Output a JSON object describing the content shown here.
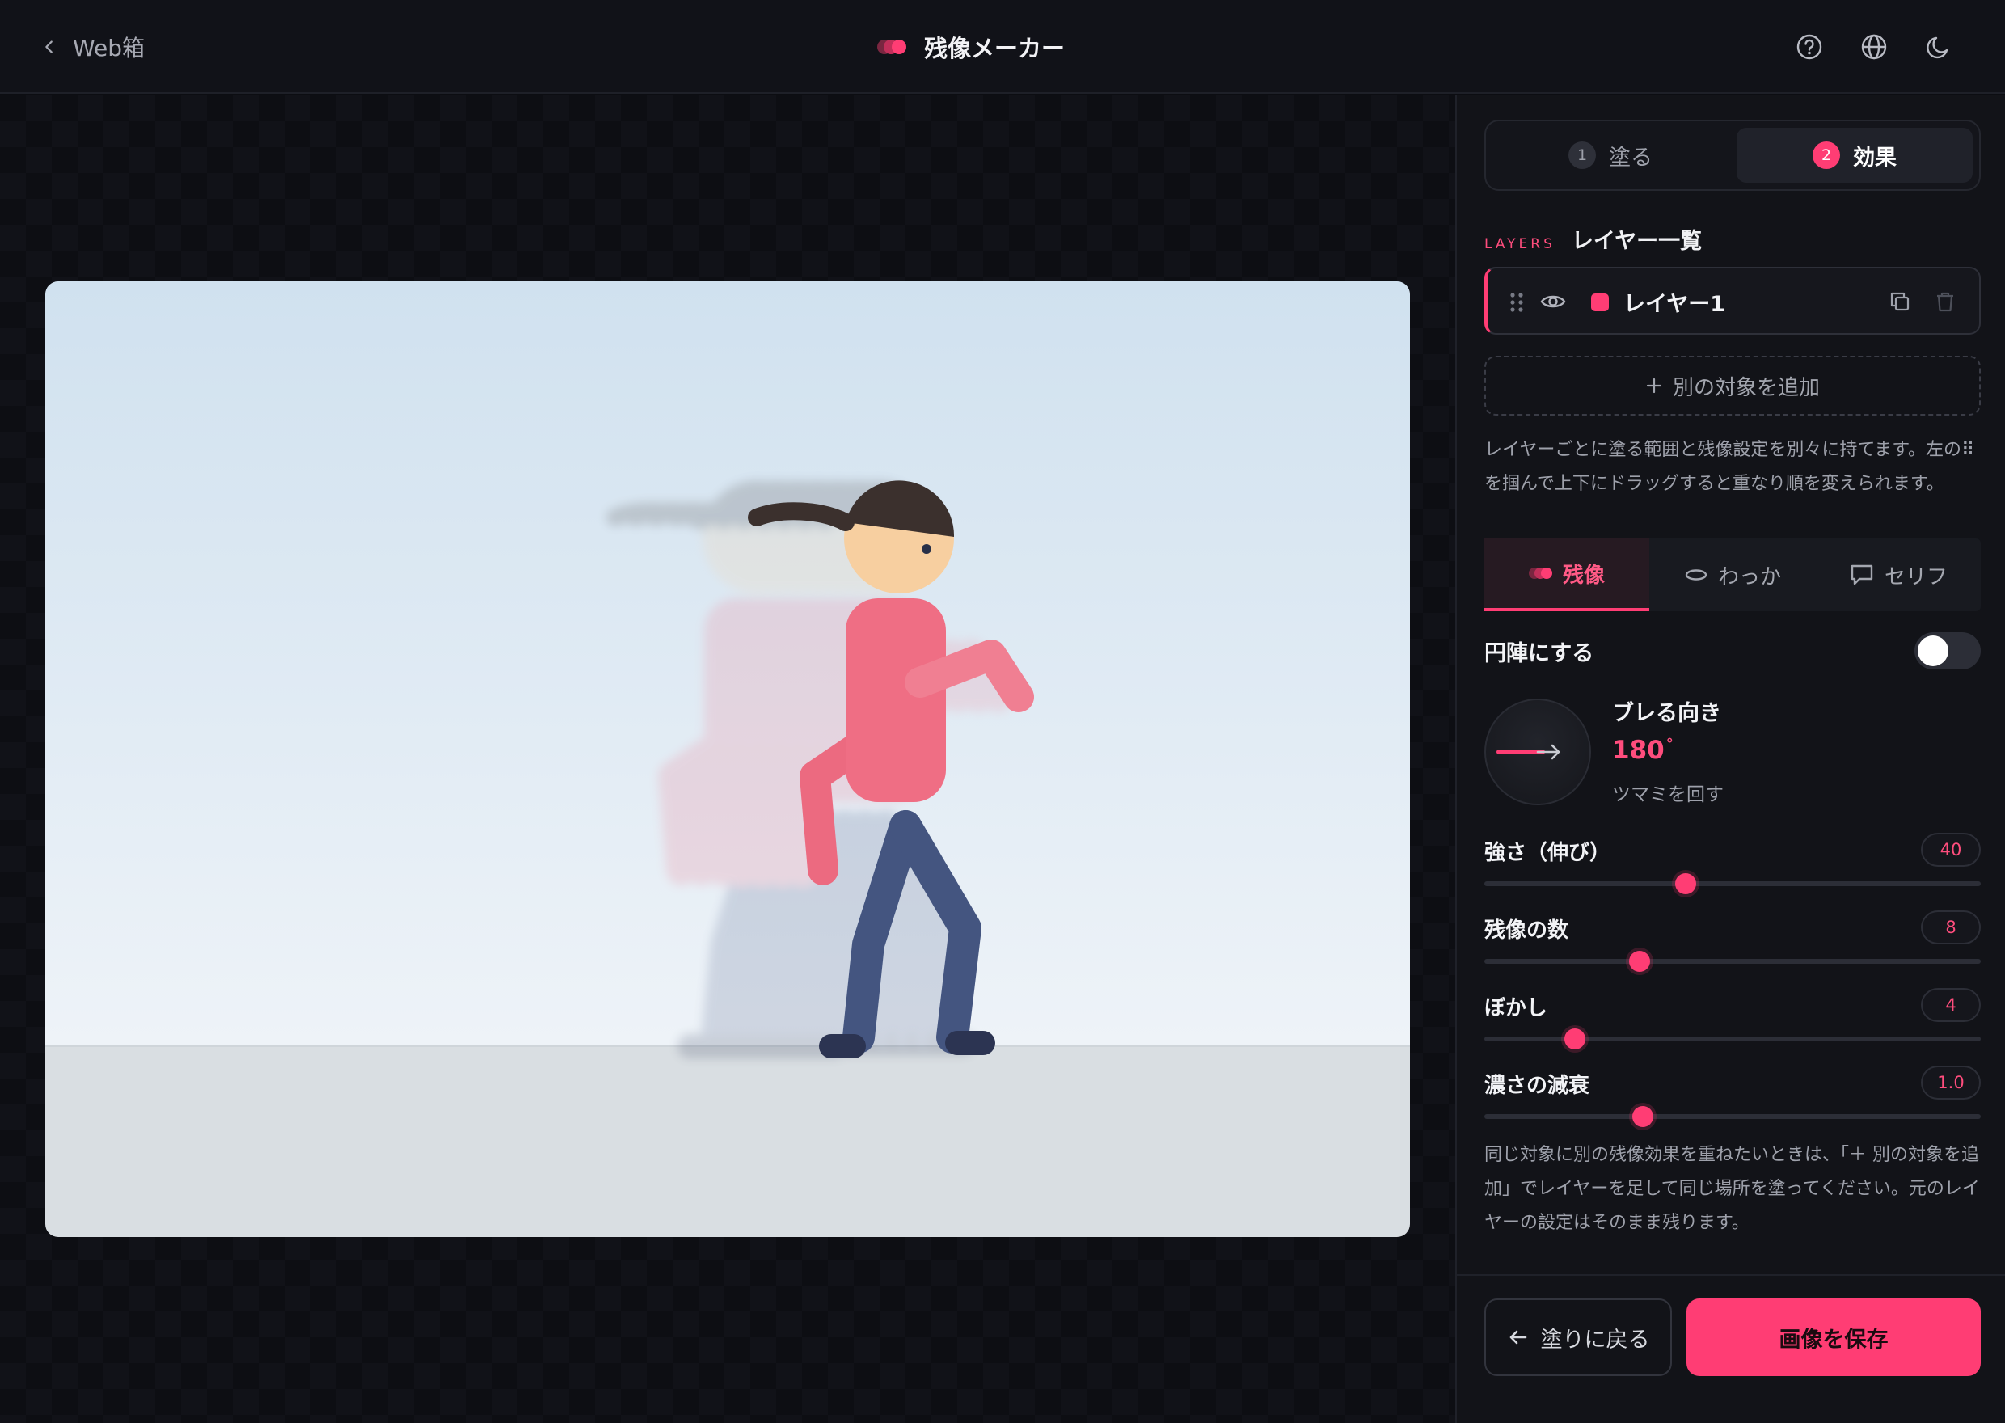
{
  "header": {
    "back_label": "Web箱",
    "app_title": "残像メーカー",
    "icons": [
      "help-icon",
      "globe-icon",
      "moon-icon"
    ]
  },
  "steps": [
    {
      "num": "1",
      "label": "塗る",
      "active": false
    },
    {
      "num": "2",
      "label": "効果",
      "active": true
    }
  ],
  "layers": {
    "tag": "LAYERS",
    "title": "レイヤー一覧",
    "items": [
      {
        "name": "レイヤー1",
        "color": "#ff3d74",
        "visible": true
      }
    ],
    "add_label": "別の対象を追加",
    "note": "レイヤーごとに塗る範囲と残像設定を別々に持てます。左の⠿を掴んで上下にドラッグすると重なり順を変えられます。"
  },
  "effect_tabs": [
    {
      "label": "残像",
      "icon": "afterimage-icon",
      "active": true
    },
    {
      "label": "わっか",
      "icon": "ring-icon",
      "active": false
    },
    {
      "label": "セリフ",
      "icon": "speech-bubble-icon",
      "active": false
    }
  ],
  "settings": {
    "circle_toggle_label": "円陣にする",
    "circle_toggle_on": false,
    "direction": {
      "title": "ブレる向き",
      "value": "180",
      "unit": "°",
      "hint": "ツマミを回す"
    },
    "sliders": [
      {
        "label": "強さ（伸び）",
        "value": "40",
        "fraction": 0.405
      },
      {
        "label": "残像の数",
        "value": "8",
        "fraction": 0.313
      },
      {
        "label": "ぼかし",
        "value": "4",
        "fraction": 0.183
      },
      {
        "label": "濃さの減衰",
        "value": "1.0",
        "fraction": 0.32
      }
    ],
    "note": "同じ対象に別の残像効果を重ねたいときは、「＋ 別の対象を追加」でレイヤーを足して同じ場所を塗ってください。元のレイヤーの設定はそのまま残ります。"
  },
  "footer": {
    "back_label": "塗りに戻る",
    "save_label": "画像を保存"
  },
  "colors": {
    "accent": "#ff3d74",
    "accent_text": "#ff4d7d",
    "background": "#0c0d12",
    "panel": "#121318"
  }
}
